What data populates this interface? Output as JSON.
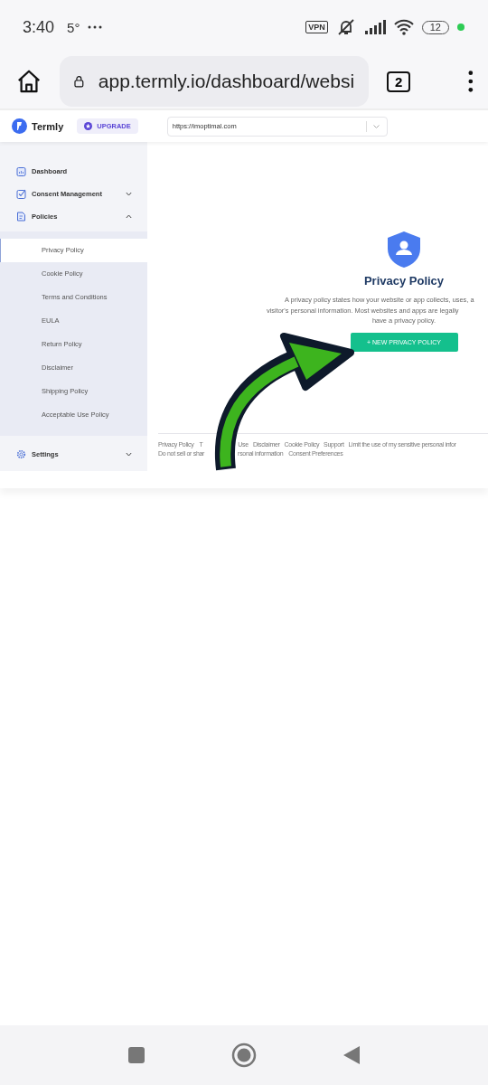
{
  "status_bar": {
    "time": "3:40",
    "temperature": "5°",
    "vpn": "VPN",
    "battery": "12"
  },
  "browser": {
    "url": "app.termly.io/dashboard/websi",
    "tab_count": "2"
  },
  "header": {
    "brand": "Termly",
    "upgrade": "UPGRADE",
    "website_select": "https://imoptimal.com"
  },
  "sidebar": {
    "items": [
      {
        "label": "Dashboard",
        "kind": "link"
      },
      {
        "label": "Consent Management",
        "kind": "group",
        "expanded": false
      },
      {
        "label": "Policies",
        "kind": "group",
        "expanded": true,
        "children": [
          {
            "label": "Privacy Policy",
            "selected": true
          },
          {
            "label": "Cookie Policy",
            "selected": false
          },
          {
            "label": "Terms and Conditions",
            "selected": false
          },
          {
            "label": "EULA",
            "selected": false
          },
          {
            "label": "Return Policy",
            "selected": false
          },
          {
            "label": "Disclaimer",
            "selected": false
          },
          {
            "label": "Shipping Policy",
            "selected": false
          },
          {
            "label": "Acceptable Use Policy",
            "selected": false
          }
        ]
      },
      {
        "label": "Settings",
        "kind": "group",
        "expanded": false
      }
    ]
  },
  "main": {
    "title": "Privacy Policy",
    "description_lines": [
      "A privacy policy states how your website or app collects, uses, a",
      "visitor's personal information. Most websites and apps are legally",
      "have a privacy policy."
    ],
    "button": "+ NEW PRIVACY POLICY"
  },
  "footer": {
    "lines": [
      {
        "links": [
          "Privacy Policy",
          "T",
          "Use",
          "Disclaimer",
          "Cookie Policy",
          "Support",
          "Limit the use of my sensitive personal infor"
        ]
      },
      {
        "links": [
          "Do not sell or shar",
          "rsonal information",
          "Consent Preferences"
        ]
      }
    ]
  }
}
